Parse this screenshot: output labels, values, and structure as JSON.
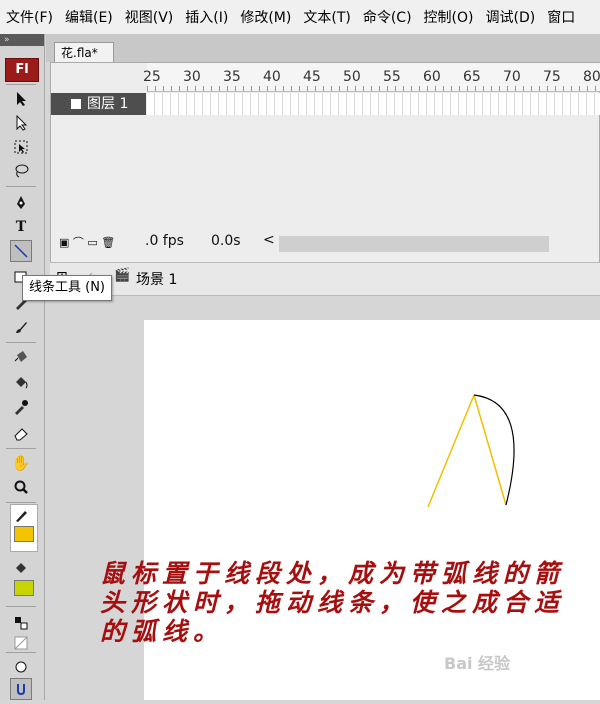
{
  "menu": [
    "文件(F)",
    "编辑(E)",
    "视图(V)",
    "插入(I)",
    "修改(M)",
    "文本(T)",
    "命令(C)",
    "控制(O)",
    "调试(D)",
    "窗口"
  ],
  "toolbox": {
    "logo": "Fl",
    "tooltip": "线条工具 (N)",
    "stroke_color": "#000000",
    "fill_color": "#f5c400",
    "fill_color2": "#c8d400"
  },
  "document": {
    "tab": "花.fla*"
  },
  "timeline": {
    "ruler": [
      "25",
      "30",
      "35",
      "40",
      "45",
      "50",
      "55",
      "60",
      "65",
      "70",
      "75",
      "80"
    ],
    "layer_name": "图层 1",
    "fps": ".0 fps",
    "time": "0.0s"
  },
  "edit_bar": {
    "scene": "场景 1"
  },
  "stage": {
    "caption": "鼠标置于线段处，成为带弧线的箭头形状时，拖动线条，使之成合适的弧线。",
    "line_color": "#f0c000",
    "curve_color": "#000000"
  },
  "watermark": "Bai 经验"
}
